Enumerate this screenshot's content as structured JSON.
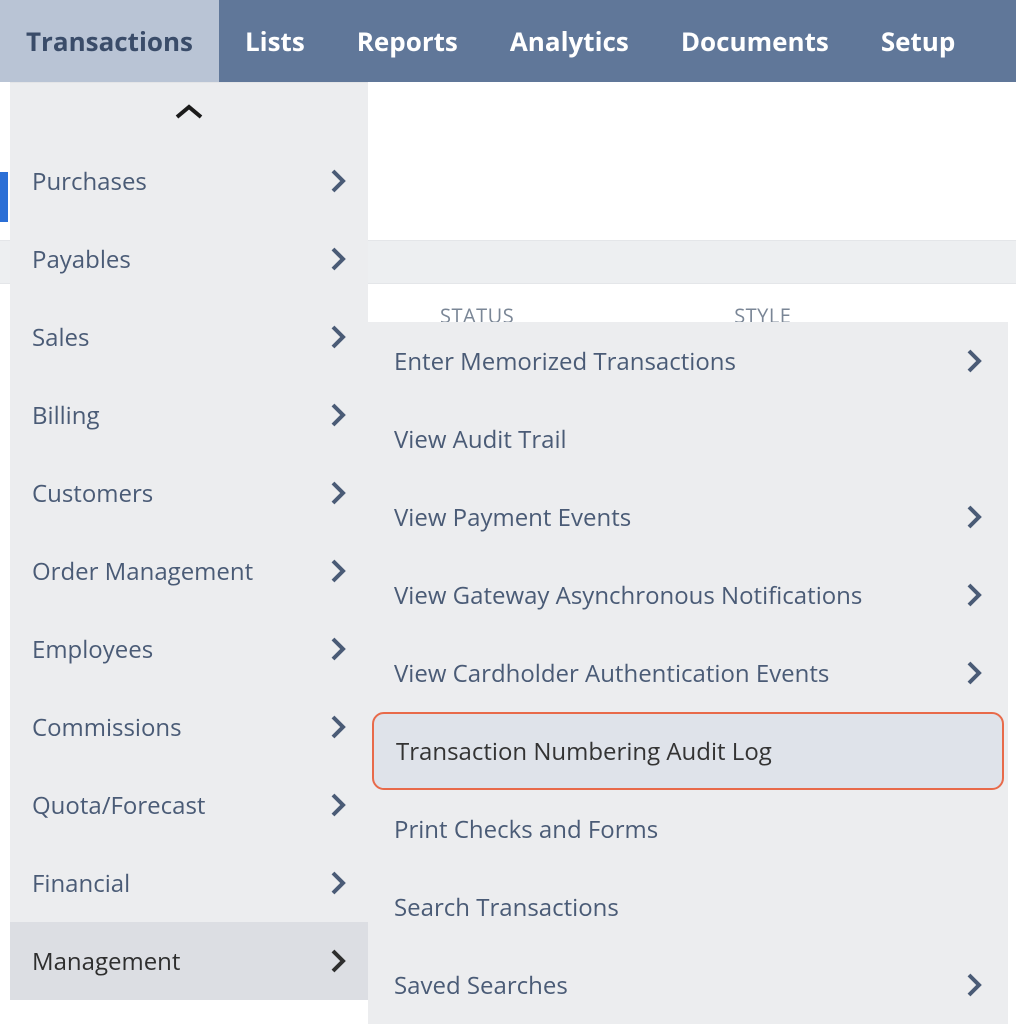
{
  "nav": {
    "items": [
      {
        "label": "Transactions",
        "active": true
      },
      {
        "label": "Lists",
        "active": false
      },
      {
        "label": "Reports",
        "active": false
      },
      {
        "label": "Analytics",
        "active": false
      },
      {
        "label": "Documents",
        "active": false
      },
      {
        "label": "Setup",
        "active": false
      }
    ]
  },
  "background_headers": {
    "col1": "STATUS",
    "col2": "STYLE"
  },
  "transactions_menu": {
    "items": [
      {
        "label": "Purchases",
        "has_submenu": true,
        "selected": false
      },
      {
        "label": "Payables",
        "has_submenu": true,
        "selected": false
      },
      {
        "label": "Sales",
        "has_submenu": true,
        "selected": false
      },
      {
        "label": "Billing",
        "has_submenu": true,
        "selected": false
      },
      {
        "label": "Customers",
        "has_submenu": true,
        "selected": false
      },
      {
        "label": "Order Management",
        "has_submenu": true,
        "selected": false
      },
      {
        "label": "Employees",
        "has_submenu": true,
        "selected": false
      },
      {
        "label": "Commissions",
        "has_submenu": true,
        "selected": false
      },
      {
        "label": "Quota/Forecast",
        "has_submenu": true,
        "selected": false
      },
      {
        "label": "Financial",
        "has_submenu": true,
        "selected": false
      },
      {
        "label": "Management",
        "has_submenu": true,
        "selected": true
      }
    ]
  },
  "management_submenu": {
    "items": [
      {
        "label": "Enter Memorized Transactions",
        "has_submenu": true,
        "highlight": false
      },
      {
        "label": "View Audit Trail",
        "has_submenu": false,
        "highlight": false
      },
      {
        "label": "View Payment Events",
        "has_submenu": true,
        "highlight": false
      },
      {
        "label": "View Gateway Asynchronous Notifications",
        "has_submenu": true,
        "highlight": false
      },
      {
        "label": "View Cardholder Authentication Events",
        "has_submenu": true,
        "highlight": false
      },
      {
        "label": "Transaction Numbering Audit Log",
        "has_submenu": false,
        "highlight": true
      },
      {
        "label": "Print Checks and Forms",
        "has_submenu": false,
        "highlight": false
      },
      {
        "label": "Search Transactions",
        "has_submenu": false,
        "highlight": false
      },
      {
        "label": "Saved Searches",
        "has_submenu": true,
        "highlight": false
      }
    ]
  }
}
